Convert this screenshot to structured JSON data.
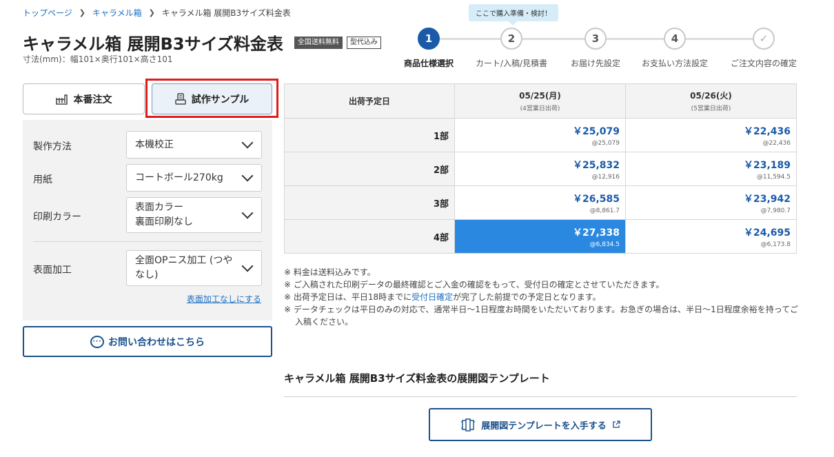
{
  "breadcrumb": {
    "items": [
      "トップページ",
      "キャラメル箱"
    ],
    "current": "キャラメル箱 展開B3サイズ料金表"
  },
  "title": "キャラメル箱 展開B3サイズ料金表",
  "badges": [
    "全国送料無料",
    "型代込み"
  ],
  "dimensions": "寸法(mm)：幅101×奥行101×高さ101",
  "steps": {
    "tooltip": "ここで購入準備・検討！",
    "items": [
      {
        "number": "1",
        "label": "商品仕様選択"
      },
      {
        "number": "2",
        "label": "カート/入稿/見積書"
      },
      {
        "number": "3",
        "label": "お届け先設定"
      },
      {
        "number": "4",
        "label": "お支払い方法設定"
      },
      {
        "number": "✓",
        "label": "ご注文内容の確定"
      }
    ]
  },
  "order_tabs": [
    "本番注文",
    "試作サンプル"
  ],
  "options": [
    {
      "label": "製作方法",
      "value": "本機校正"
    },
    {
      "label": "用紙",
      "value": "コートボール270kg"
    },
    {
      "label": "印刷カラー",
      "value": "表面カラー\n裏面印刷なし"
    },
    {
      "label": "表面加工",
      "value": "全面OPニス加工 (つやなし)"
    }
  ],
  "no_coating_link": "表面加工なしにする",
  "contact_button": "お問い合わせはこちら",
  "price_table": {
    "header_label": "出荷予定日",
    "columns": [
      {
        "date": "05/25(月)",
        "sub": "(4営業日出荷)"
      },
      {
        "date": "05/26(火)",
        "sub": "(5営業日出荷)"
      }
    ],
    "rows": [
      {
        "qty": "1部",
        "cells": [
          {
            "price": "￥25,079",
            "unit": "@25,079"
          },
          {
            "price": "￥22,436",
            "unit": "@22,436"
          }
        ]
      },
      {
        "qty": "2部",
        "cells": [
          {
            "price": "￥25,832",
            "unit": "@12,916"
          },
          {
            "price": "￥23,189",
            "unit": "@11,594.5"
          }
        ]
      },
      {
        "qty": "3部",
        "cells": [
          {
            "price": "￥26,585",
            "unit": "@8,861.7"
          },
          {
            "price": "￥23,942",
            "unit": "@7,980.7"
          }
        ]
      },
      {
        "qty": "4部",
        "cells": [
          {
            "price": "￥27,338",
            "unit": "@6,834.5"
          },
          {
            "price": "￥24,695",
            "unit": "@6,173.8"
          }
        ]
      }
    ]
  },
  "notes": {
    "n1": "※ 料金は送料込みです。",
    "n2": "※ ご入稿された印刷データの最終確認とご入金の確認をもって、受付日の確定とさせていただきます。",
    "n3_pre": "※ 出荷予定日は、平日18時までに",
    "n3_link": "受付日確定",
    "n3_post": "が完了した前提での予定日となります。",
    "n4": "※ データチェックは平日のみの対応で、通常半日〜1日程度お時間をいただいております。お急ぎの場合は、半日〜1日程度余裕を持ってご入稿ください。"
  },
  "template_section": {
    "title": "キャラメル箱 展開B3サイズ料金表の展開図テンプレート",
    "button": "展開図テンプレートを入手する"
  }
}
